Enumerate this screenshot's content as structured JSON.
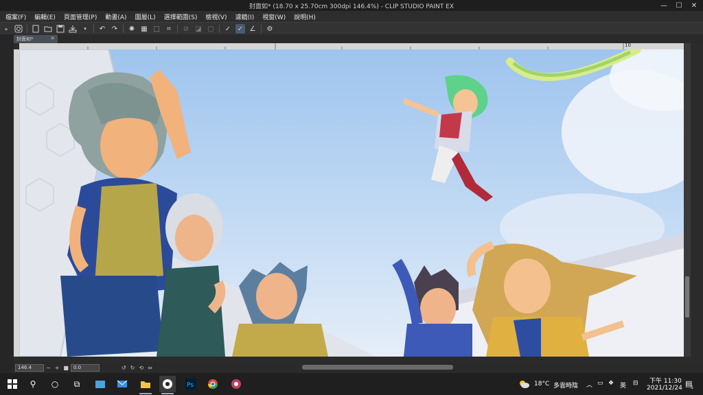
{
  "window": {
    "title": "封面如* (18.70 x 25.70cm 300dpi 146.4%) - CLIP STUDIO PAINT EX",
    "controls": [
      "—",
      "☐",
      "✕"
    ]
  },
  "menu": [
    "檔案(F)",
    "編輯(E)",
    "頁面管理(P)",
    "動畫(A)",
    "圖層(L)",
    "選擇範圍(S)",
    "檢視(V)",
    "濾鏡(I)",
    "視窗(W)",
    "說明(H)"
  ],
  "toolbar_icons": [
    "clip-studio-icon",
    "new-icon",
    "open-icon",
    "save-icon",
    "export-icon",
    "undo-icon",
    "redo-icon",
    "clear-icon",
    "fill-icon",
    "transform-icon",
    "crop-icon",
    "hide-icon",
    "toggle-icon",
    "select-all-icon",
    "pen-stabilizer-icon",
    "pen-active-icon",
    "pen-angle-icon",
    "settings-icon"
  ],
  "tab": {
    "label": "封面如*",
    "close": "×"
  },
  "ruler": {
    "mark_10": "10"
  },
  "status": {
    "zoom": "146.4",
    "angle": "0.0"
  },
  "taskbar": {
    "weather": "18°C",
    "weather_desc": "多雲時陰",
    "ime": "英",
    "time": "下午 11:30",
    "date": "2021/12/24",
    "notification_count": "5"
  }
}
